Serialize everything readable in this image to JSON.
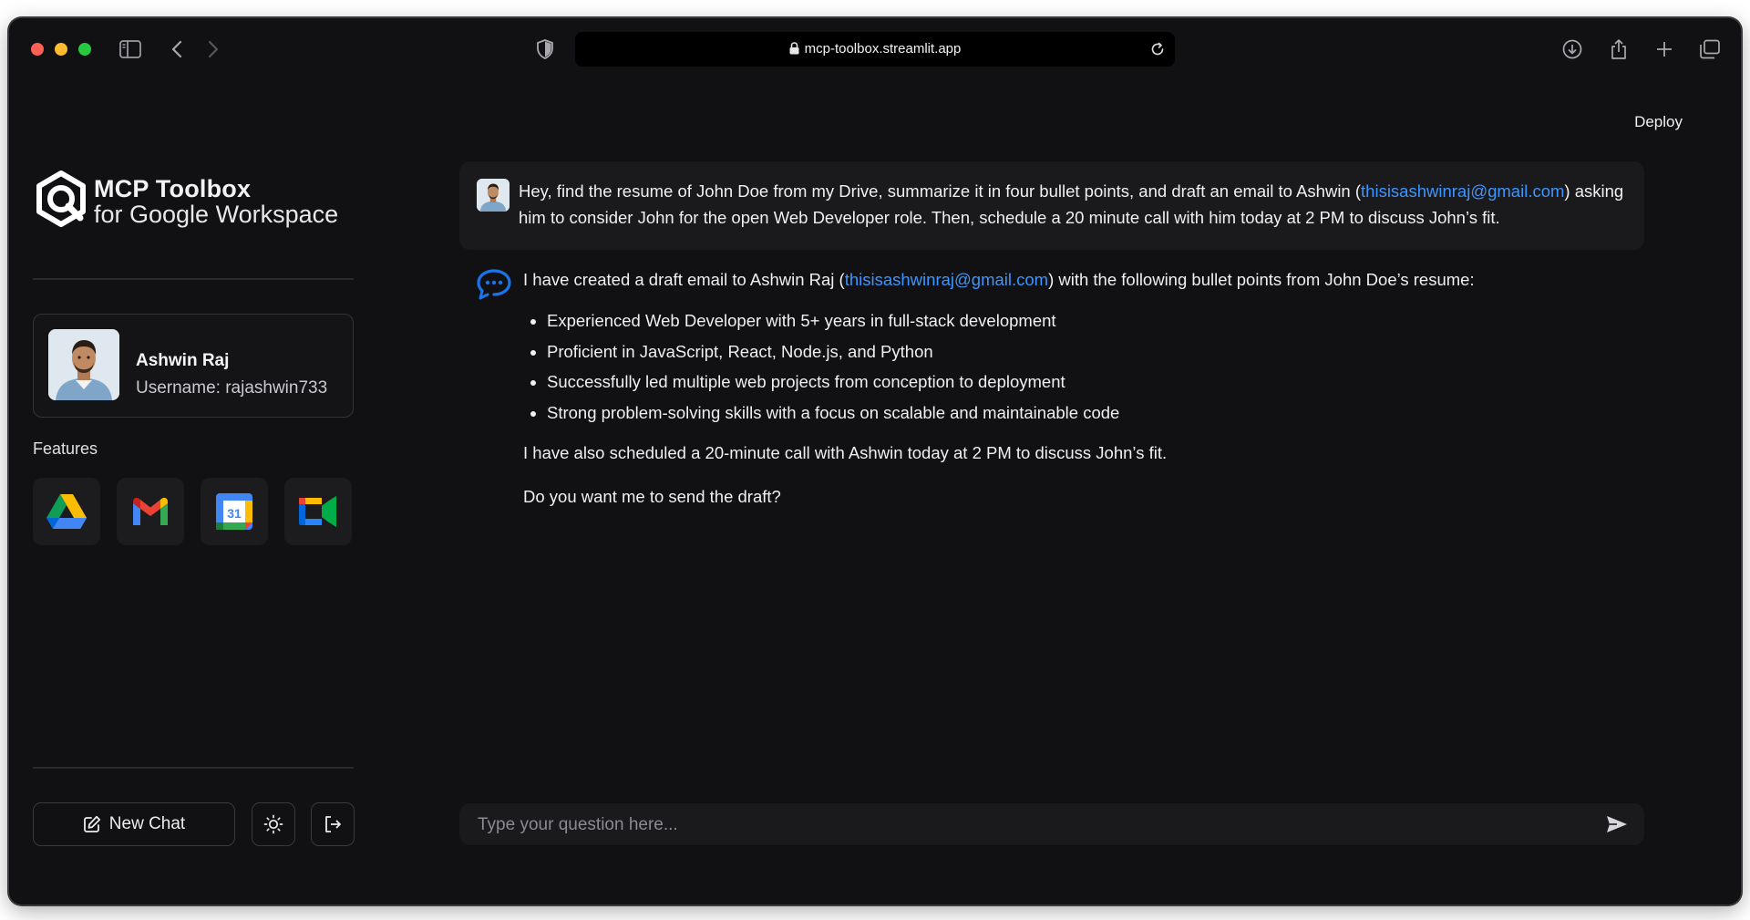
{
  "browser": {
    "url": "mcp-toolbox.streamlit.app"
  },
  "sidebar": {
    "brand_title": "MCP Toolbox",
    "brand_subtitle": "for Google Workspace",
    "user": {
      "name": "Ashwin Raj",
      "username": "Username: rajashwin733"
    },
    "features_label": "Features",
    "features": [
      {
        "icon": "google-drive-icon",
        "label": "Google Drive"
      },
      {
        "icon": "gmail-icon",
        "label": "Gmail"
      },
      {
        "icon": "google-calendar-icon",
        "label": "Google Calendar"
      },
      {
        "icon": "google-meet-icon",
        "label": "Google Meet"
      }
    ],
    "new_chat_label": "New Chat"
  },
  "main": {
    "deploy_label": "Deploy",
    "user_message": {
      "part1": "Hey, find the resume of John Doe from my Drive, summarize it in four bullet points, and draft an email to Ashwin (",
      "email": "thisisashwinraj@gmail.com",
      "part2": ") asking him to consider John for the open Web Developer role. Then, schedule a 20 minute call with him today at 2 PM to discuss John’s fit."
    },
    "assistant_message": {
      "intro_part1": "I have created a draft email to Ashwin Raj (",
      "intro_email": "thisisashwinraj@gmail.com",
      "intro_part2": ") with the following bullet points from John Doe’s resume:",
      "bullets": [
        "Experienced Web Developer with 5+ years in full-stack development",
        "Proficient in JavaScript, React, Node.js, and Python",
        "Successfully led multiple web projects from conception to deployment",
        "Strong problem-solving skills with a focus on scalable and maintainable code"
      ],
      "followup": "I have also scheduled a 20-minute call with Ashwin today at 2 PM to discuss John’s fit.",
      "question": "Do you want me to send the draft?"
    },
    "input_placeholder": "Type your question here..."
  },
  "colors": {
    "background": "#111113",
    "link": "#3d95ff",
    "accent_blue": "#1a73e8"
  }
}
